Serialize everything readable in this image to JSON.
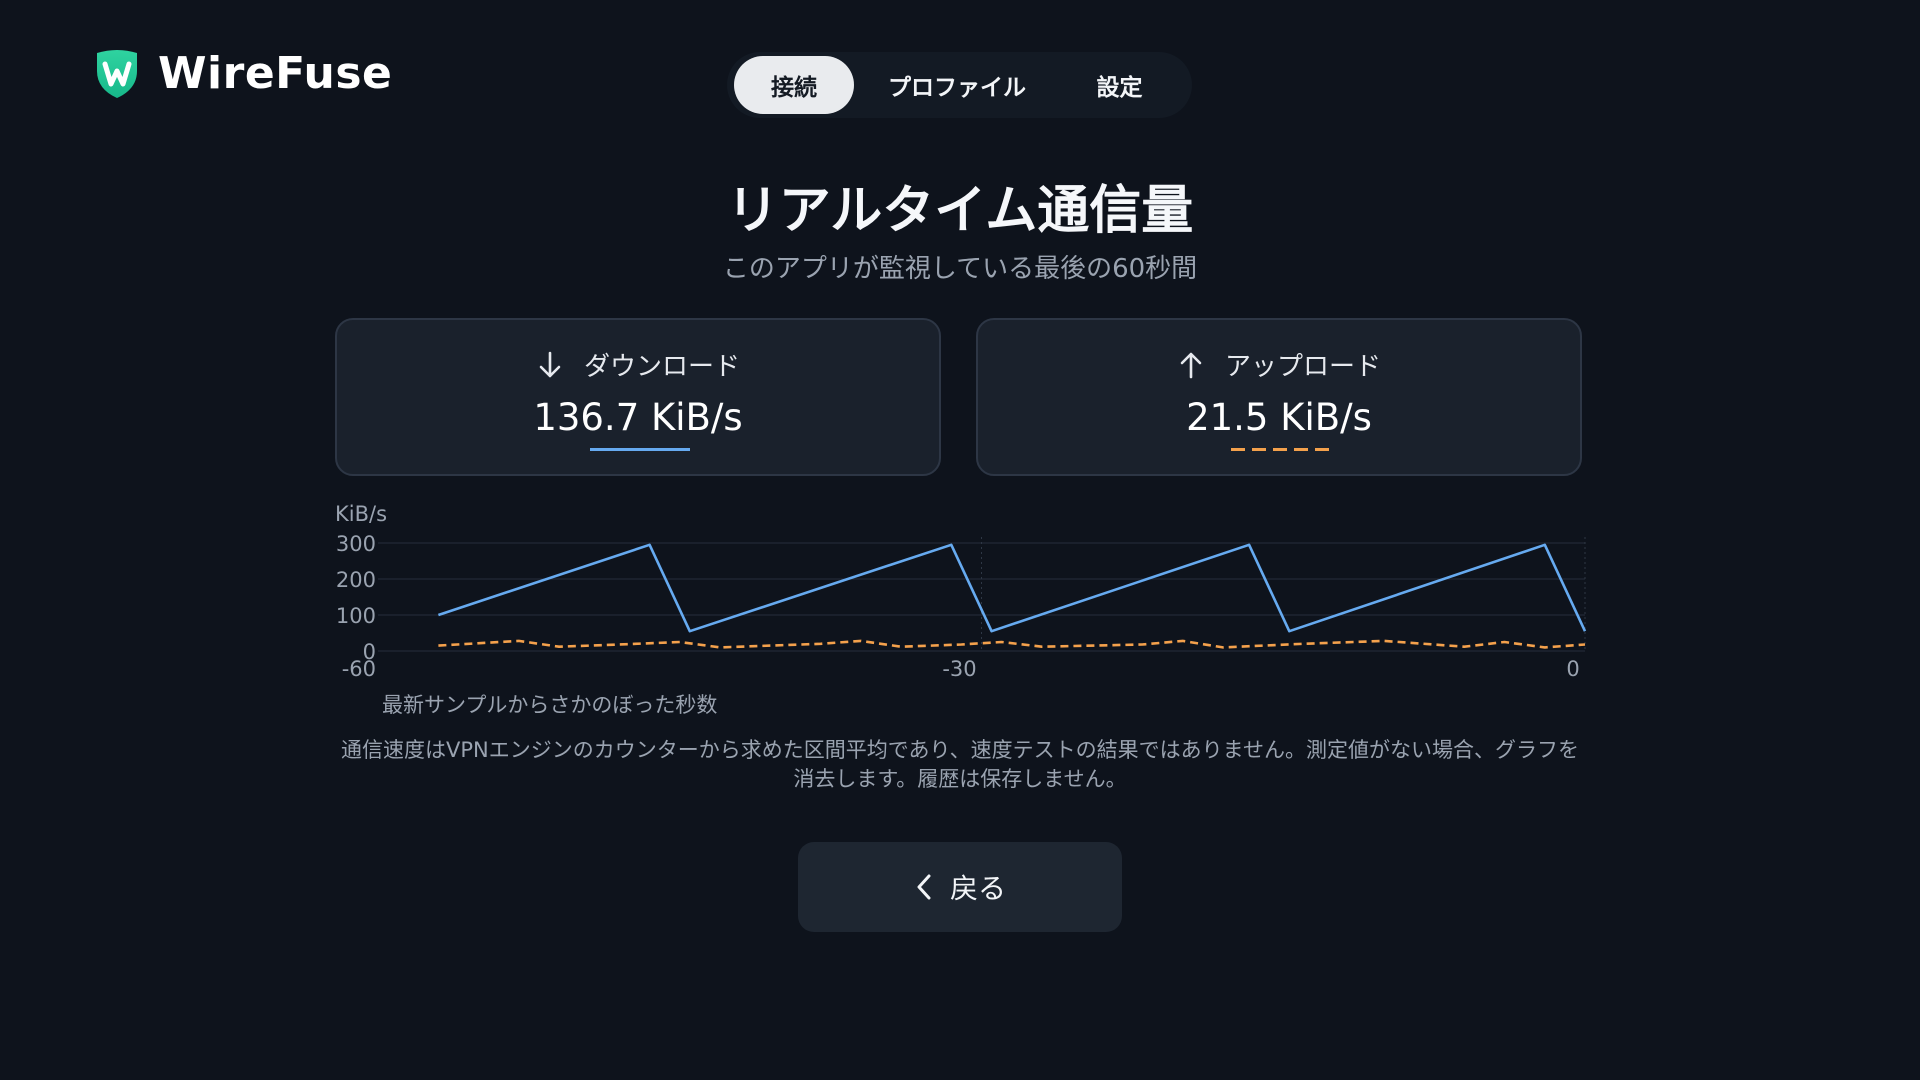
{
  "app": {
    "name": "WireFuse"
  },
  "tabs": [
    {
      "label": "接続",
      "active": true
    },
    {
      "label": "プロファイル",
      "active": false
    },
    {
      "label": "設定",
      "active": false
    }
  ],
  "page": {
    "title": "リアルタイム通信量",
    "subtitle": "このアプリが監視している最後の60秒間"
  },
  "download": {
    "label": "ダウンロード",
    "value": "136.7 KiB/s",
    "icon": "arrow-down-icon",
    "color": "#66aaf0"
  },
  "upload": {
    "label": "アップロード",
    "value": "21.5 KiB/s",
    "icon": "arrow-up-icon",
    "color": "#f4a14c"
  },
  "chart_data": {
    "type": "line",
    "ylabel": "KiB/s",
    "xlabel": "最新サンプルからさかのぼった秒数",
    "xlim": [
      -60,
      0
    ],
    "ylim": [
      0,
      300
    ],
    "yticks": [
      0,
      100,
      200,
      300
    ],
    "xticks": [
      -60,
      -30,
      0
    ],
    "grid": true,
    "series": [
      {
        "name": "ダウンロード",
        "color": "#66aaf0",
        "style": "solid",
        "x": [
          -57,
          -46.5,
          -44.5,
          -31.5,
          -29.5,
          -16.7,
          -14.7,
          -2,
          0
        ],
        "y": [
          100,
          295,
          55,
          295,
          55,
          295,
          55,
          295,
          55
        ]
      },
      {
        "name": "アップロード",
        "color": "#f4a14c",
        "style": "dashed",
        "x": [
          -57,
          -53,
          -51,
          -48,
          -45,
          -43,
          -38,
          -36,
          -34,
          -31,
          -29,
          -27,
          -22,
          -20,
          -18,
          -16,
          -14,
          -10,
          -6,
          -4,
          -2,
          0
        ],
        "y": [
          15,
          28,
          12,
          18,
          25,
          10,
          20,
          28,
          12,
          18,
          25,
          12,
          18,
          28,
          10,
          15,
          20,
          28,
          12,
          25,
          10,
          18
        ]
      }
    ]
  },
  "footnote": "通信速度はVPNエンジンのカウンターから求めた区間平均であり、速度テストの結果ではありません。測定値がない場合、グラフを消去します。履歴は保存しません。",
  "back_button": {
    "label": "戻る"
  }
}
